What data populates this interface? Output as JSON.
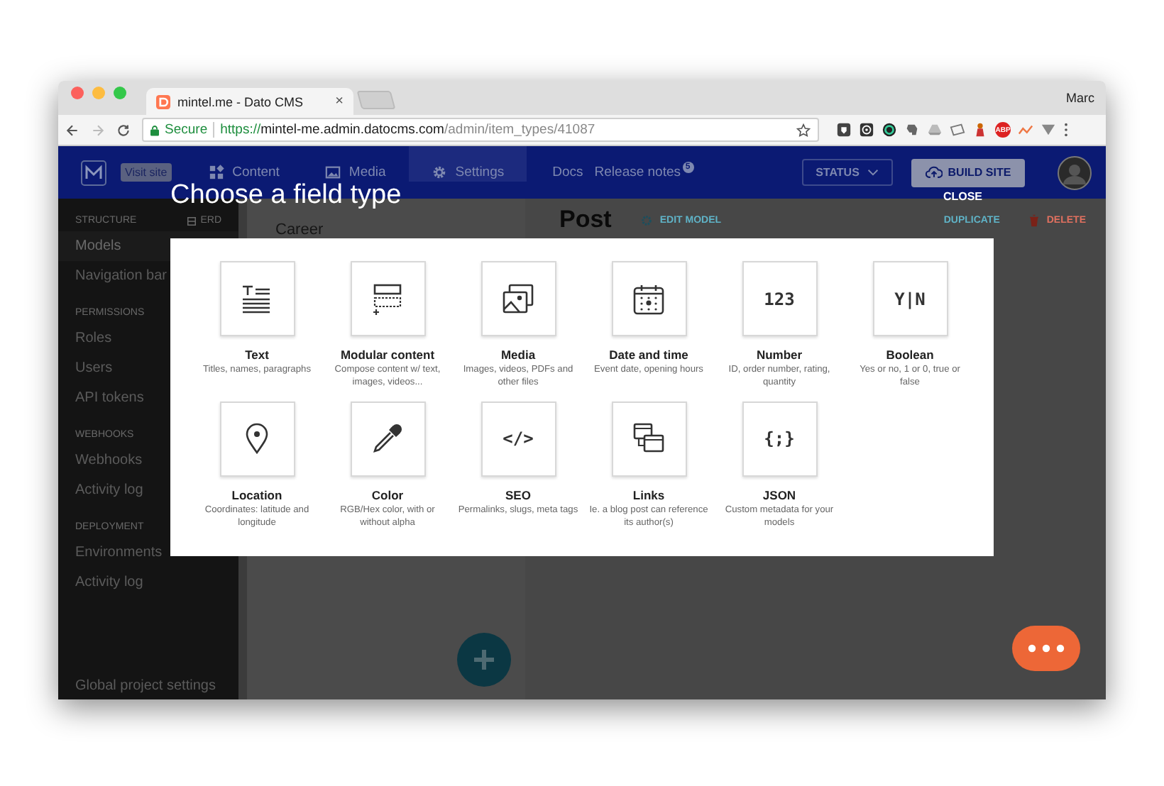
{
  "browser": {
    "tab_title": "mintel.me - Dato CMS",
    "tab_close": "×",
    "profile": "Marc",
    "secure_label": "Secure",
    "url": {
      "scheme": "https://",
      "host": "mintel-me.admin.datocms.com",
      "path": "/admin/item_types/41087"
    },
    "adblock": "ABP"
  },
  "header": {
    "visit_site": "Visit site",
    "nav": [
      {
        "kind": "content",
        "label": "Content",
        "selected": false
      },
      {
        "kind": "media",
        "label": "Media",
        "selected": false
      },
      {
        "kind": "settings",
        "label": "Settings",
        "selected": true
      }
    ],
    "docs": "Docs",
    "release_notes": "Release notes",
    "release_badge": "5",
    "status": "STATUS",
    "build": "BUILD SITE"
  },
  "sidebar": {
    "sections": [
      {
        "title": "STRUCTURE",
        "action": "ERD",
        "items": [
          {
            "label": "Models",
            "selected": true
          },
          {
            "label": "Navigation bar",
            "selected": false
          }
        ]
      },
      {
        "title": "PERMISSIONS",
        "items": [
          {
            "label": "Roles",
            "selected": false
          },
          {
            "label": "Users",
            "selected": false
          },
          {
            "label": "API tokens",
            "selected": false
          }
        ]
      },
      {
        "title": "WEBHOOKS",
        "items": [
          {
            "label": "Webhooks",
            "selected": false
          },
          {
            "label": "Activity log",
            "selected": false
          }
        ]
      },
      {
        "title": "DEPLOYMENT",
        "items": [
          {
            "label": "Environments",
            "selected": false
          },
          {
            "label": "Activity log",
            "selected": false
          }
        ]
      }
    ],
    "footer": "Global project settings"
  },
  "list": {
    "items": [
      "Career"
    ]
  },
  "record": {
    "title": "Post",
    "edit": "EDIT MODEL",
    "duplicate": "DUPLICATE",
    "delete": "DELETE"
  },
  "modal": {
    "title": "Choose a field type",
    "close": "CLOSE",
    "fields": [
      {
        "kind": "text",
        "label": "Text",
        "description": "Titles, names, paragraphs"
      },
      {
        "kind": "modular",
        "label": "Modular content",
        "description": "Compose content w/ text, images, videos..."
      },
      {
        "kind": "media",
        "label": "Media",
        "description": "Images, videos, PDFs and other files"
      },
      {
        "kind": "datetime",
        "label": "Date and time",
        "description": "Event date, opening hours"
      },
      {
        "kind": "number",
        "glyph": "123",
        "label": "Number",
        "description": "ID, order number, rating, quantity"
      },
      {
        "kind": "boolean",
        "glyph": "Y|N",
        "label": "Boolean",
        "description": "Yes or no, 1 or 0, true or false"
      },
      {
        "kind": "location",
        "label": "Location",
        "description": "Coordinates: latitude and longitude"
      },
      {
        "kind": "color",
        "label": "Color",
        "description": "RGB/Hex color, with or without alpha"
      },
      {
        "kind": "seo",
        "glyph": "</>",
        "label": "SEO",
        "description": "Permalinks, slugs, meta tags"
      },
      {
        "kind": "links",
        "label": "Links",
        "description": "Ie. a blog post can reference its author(s)"
      },
      {
        "kind": "json",
        "glyph": "{;}",
        "label": "JSON",
        "description": "Custom metadata for your models"
      }
    ]
  }
}
